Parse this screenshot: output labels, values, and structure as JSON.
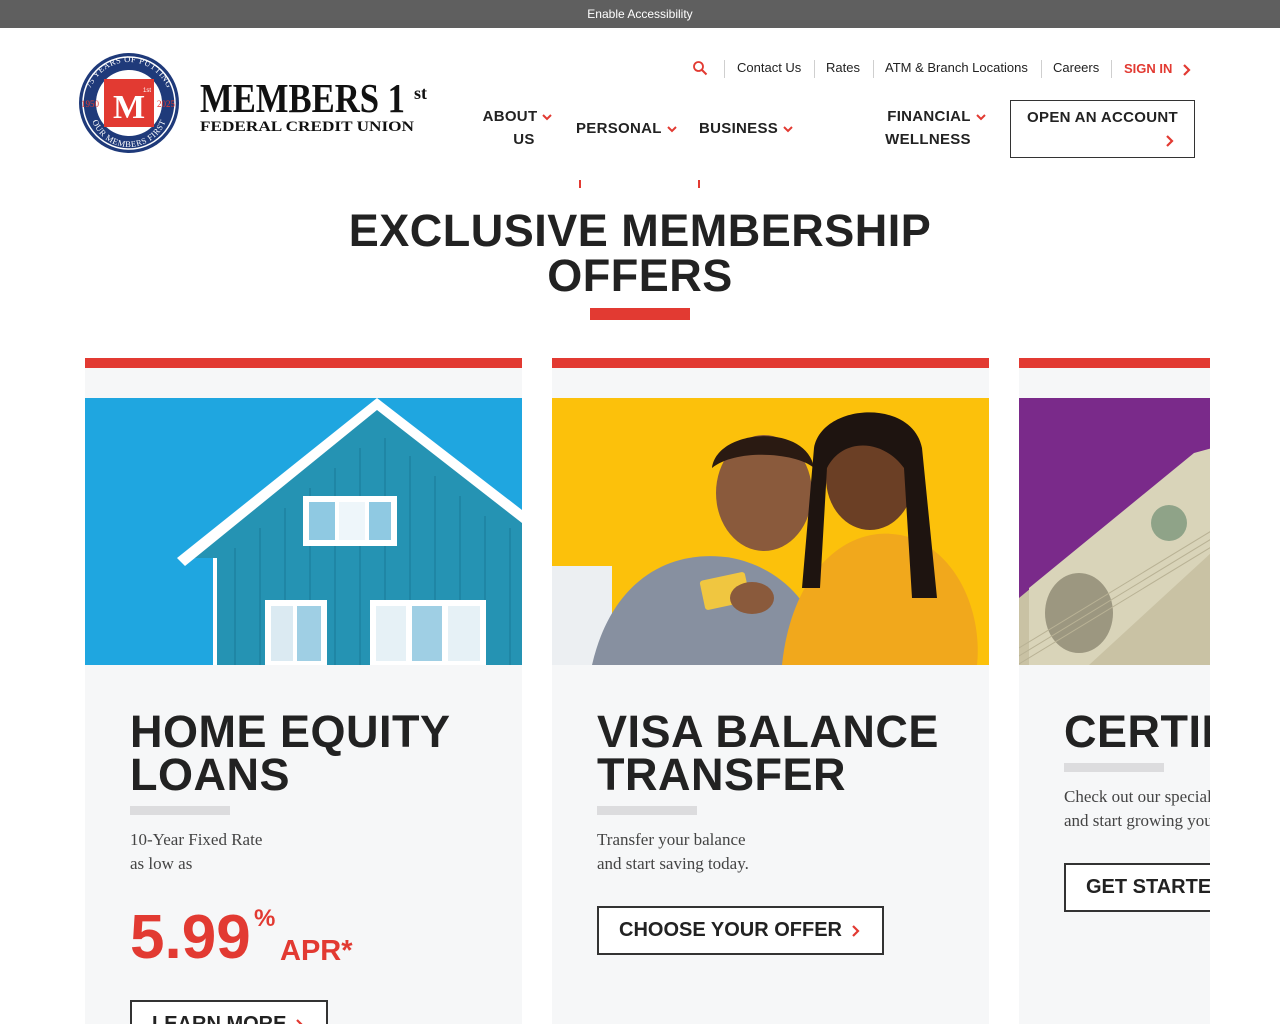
{
  "accessibility_bar": {
    "label": "Enable Accessibility"
  },
  "logo": {
    "brand_line1": "MEMBERS 1",
    "brand_sup": "st",
    "brand_line2": "FEDERAL CREDIT UNION",
    "seal_top": "75 YEARS OF PUTTING",
    "seal_bottom": "OUR MEMBERS FIRST",
    "seal_left": "1950",
    "seal_right": "2025",
    "seal_mark": "M",
    "seal_mark_sup": "1st"
  },
  "utility_nav": {
    "search_icon": "search-icon",
    "items": [
      "Contact Us",
      "Rates",
      "ATM & Branch Locations",
      "Careers"
    ],
    "sign_in": "SIGN IN"
  },
  "main_nav": {
    "about": {
      "line1": "ABOUT",
      "line2": "US"
    },
    "personal": "PERSONAL",
    "business": "BUSINESS",
    "financial": {
      "line1": "FINANCIAL",
      "line2": "WELLNESS"
    },
    "open_account": "OPEN AN ACCOUNT"
  },
  "section": {
    "title_line1": "EXCLUSIVE MEMBERSHIP",
    "title_line2": "OFFERS"
  },
  "cards": [
    {
      "title_line1": "HOME EQUITY",
      "title_line2": "LOANS",
      "desc_line1": "10-Year Fixed Rate",
      "desc_line2": "as low as",
      "rate": "5.99",
      "rate_pct": "%",
      "rate_apr": "APR*",
      "button": "LEARN MORE"
    },
    {
      "title_line1": "VISA BALANCE",
      "title_line2": "TRANSFER",
      "desc_line1": "Transfer your balance",
      "desc_line2": "and start saving today.",
      "button": "CHOOSE YOUR OFFER"
    },
    {
      "title_line1": "CERTIFICATES",
      "desc_line1": "Check out our special",
      "desc_line2": "and start growing your",
      "button": "GET STARTED"
    }
  ],
  "colors": {
    "brand_red": "#e23a32",
    "brand_navy": "#1f3a7a",
    "text_dark": "#222222",
    "card_bg": "#f6f7f8",
    "accessibility_bar": "#5f5f5f"
  }
}
